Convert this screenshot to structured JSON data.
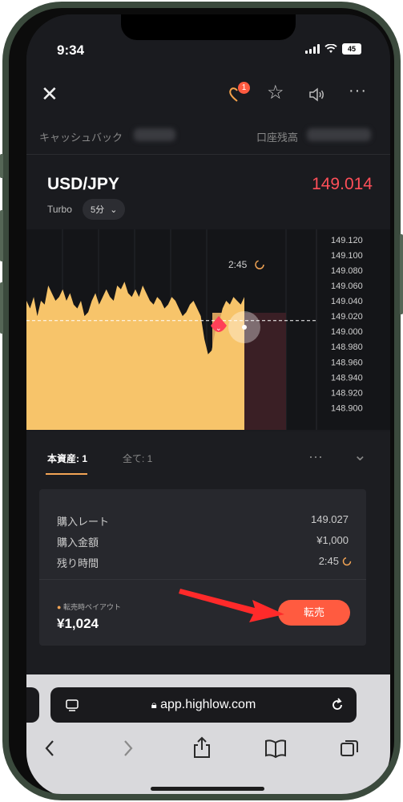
{
  "status": {
    "time": "9:34",
    "battery": "45"
  },
  "topbar": {
    "notification_count": "1"
  },
  "header": {
    "cashback_label": "キャッシュバック",
    "balance_label": "口座残高"
  },
  "asset": {
    "pair": "USD/JPY",
    "price": "149.014",
    "mode": "Turbo",
    "duration": "5分"
  },
  "chart_data": {
    "type": "area",
    "y_ticks": [
      "149.120",
      "149.100",
      "149.080",
      "149.060",
      "149.040",
      "149.020",
      "149.000",
      "148.980",
      "148.960",
      "148.940",
      "148.920",
      "148.900"
    ],
    "ylim": [
      148.89,
      149.125
    ],
    "countdown": "2:45",
    "current_rate": 149.014,
    "series": [
      {
        "values": [
          149.04,
          149.03,
          149.045,
          149.02,
          149.04,
          149.035,
          149.06,
          149.05,
          149.04,
          149.045,
          149.055,
          149.04,
          149.05,
          149.035,
          149.03,
          149.04,
          149.02,
          149.025,
          149.04,
          149.05,
          149.035,
          149.045,
          149.055,
          149.045,
          149.04,
          149.06,
          149.055,
          149.065,
          149.05,
          149.045,
          149.055,
          149.045,
          149.06,
          149.05,
          149.04,
          149.035,
          149.045,
          149.04,
          149.03,
          149.035,
          149.045,
          149.04,
          149.03,
          149.02,
          149.025,
          149.035,
          149.04,
          149.03,
          149.02,
          148.99,
          148.97,
          148.975,
          149.0,
          149.01,
          149.03,
          149.04,
          149.035,
          149.045,
          149.04,
          149.035,
          149.045
        ]
      }
    ]
  },
  "tabs": {
    "current_asset": "本資産: 1",
    "all": "全て: 1"
  },
  "position": {
    "rows": [
      {
        "label": "購入レート",
        "value": "149.027"
      },
      {
        "label": "購入金額",
        "value": "¥1,000"
      },
      {
        "label": "残り時間",
        "value": "2:45"
      }
    ],
    "payout_label": "転売時ペイアウト",
    "payout_value": "¥1,024",
    "resale_button": "転売"
  },
  "browser": {
    "url": "app.highlow.com"
  },
  "colors": {
    "accent": "#f2a455",
    "price_red": "#ff4f59",
    "resale": "#ff5b40"
  }
}
